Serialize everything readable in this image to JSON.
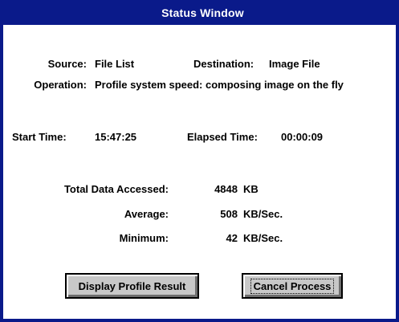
{
  "window": {
    "title": "Status Window"
  },
  "fields": {
    "source_label": "Source:",
    "source_value": "File List",
    "destination_label": "Destination:",
    "destination_value": "Image File",
    "operation_label": "Operation:",
    "operation_value": "Profile system speed: composing image on the fly",
    "start_time_label": "Start Time:",
    "start_time_value": "15:47:25",
    "elapsed_time_label": "Elapsed Time:",
    "elapsed_time_value": "00:00:09"
  },
  "stats": {
    "total_label": "Total Data Accessed:",
    "total_value": "4848",
    "total_unit": "KB",
    "average_label": "Average:",
    "average_value": "508",
    "average_unit": "KB/Sec.",
    "minimum_label": "Minimum:",
    "minimum_value": "42",
    "minimum_unit": "KB/Sec."
  },
  "buttons": {
    "display_profile_label": "Display Profile Result",
    "cancel_label": "Cancel Process"
  },
  "colors": {
    "titlebar": "#0a1a8a",
    "border": "#0a1a8a",
    "button_face": "#c8c8c8"
  }
}
